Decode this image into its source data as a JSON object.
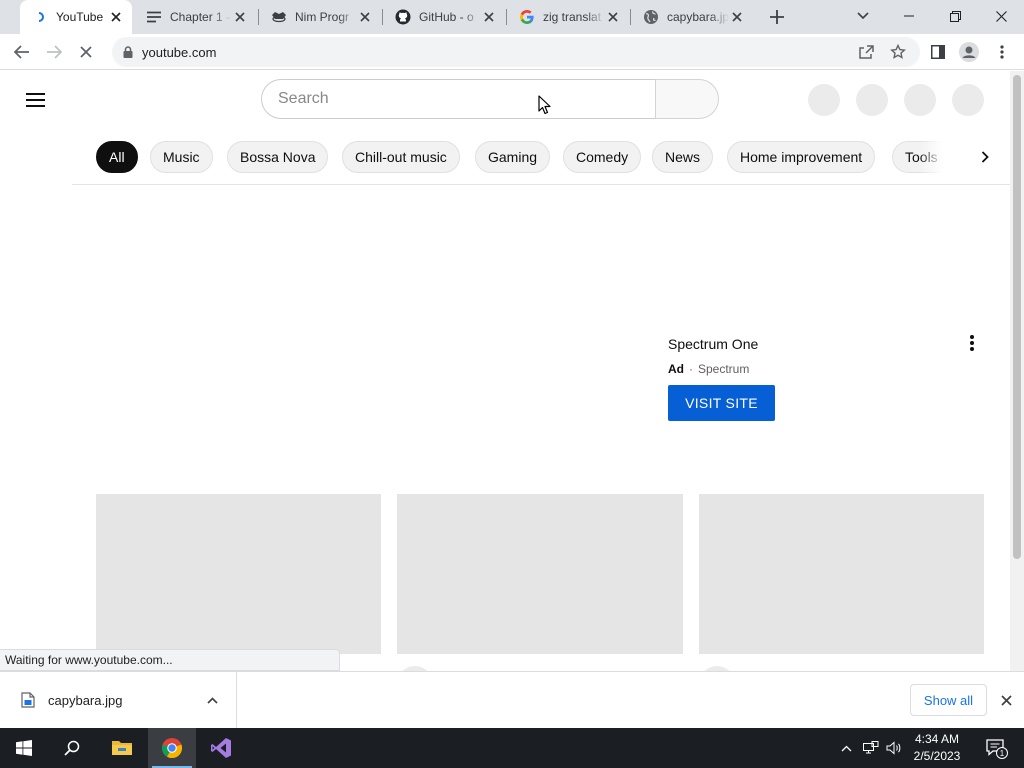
{
  "browser": {
    "tabs": [
      {
        "title": "YouTube",
        "favicon": "loading-spinner-icon",
        "active": true
      },
      {
        "title": "Chapter 1 -",
        "favicon": "document-lines-icon",
        "active": false
      },
      {
        "title": "Nim Progr",
        "favicon": "nim-crown-icon",
        "active": false
      },
      {
        "title": "GitHub - o",
        "favicon": "github-icon",
        "active": false
      },
      {
        "title": "zig translat",
        "favicon": "google-icon",
        "active": false
      },
      {
        "title": "capybara.jp",
        "favicon": "globe-icon",
        "active": false
      }
    ],
    "address": {
      "url": "youtube.com"
    },
    "status_text": "Waiting for www.youtube.com..."
  },
  "youtube": {
    "search_placeholder": "Search",
    "chips": [
      {
        "label": "All",
        "active": true
      },
      {
        "label": "Music"
      },
      {
        "label": "Bossa Nova"
      },
      {
        "label": "Chill-out music"
      },
      {
        "label": "Gaming"
      },
      {
        "label": "Comedy"
      },
      {
        "label": "News"
      },
      {
        "label": "Home improvement"
      },
      {
        "label": "Tools"
      }
    ],
    "ad": {
      "title": "Spectrum One",
      "badge": "Ad",
      "separator": "·",
      "advertiser": "Spectrum",
      "cta": "VISIT SITE"
    }
  },
  "downloads": {
    "file_name": "capybara.jpg",
    "show_all_label": "Show all"
  },
  "taskbar": {
    "time": "4:34 AM",
    "date": "2/5/2023",
    "notification_count": "1"
  },
  "colors": {
    "accent_blue": "#065fd4",
    "chip_active": "#0f0f0f",
    "chrome_tabstrip": "#dee1e6",
    "taskbar": "#1b1e22"
  }
}
